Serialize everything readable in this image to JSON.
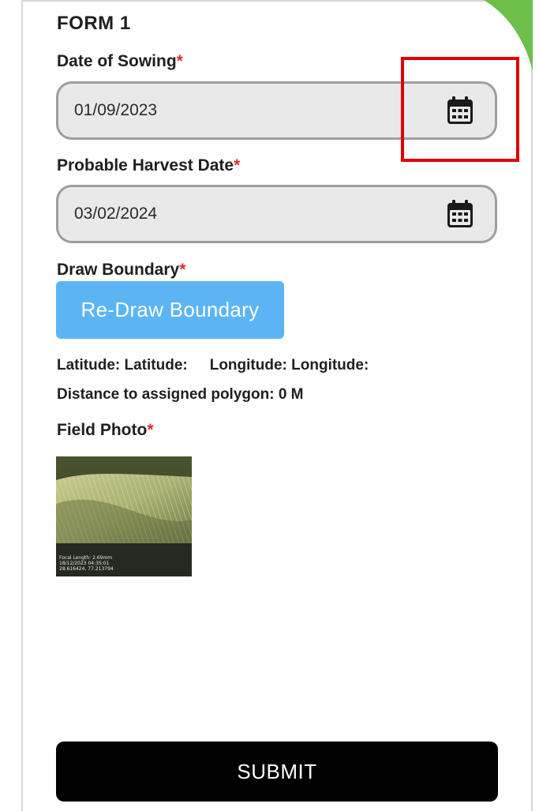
{
  "form": {
    "title": "FORM 1"
  },
  "sowing": {
    "label": "Date of Sowing",
    "required_mark": "*",
    "value": "01/09/2023"
  },
  "harvest": {
    "label": "Probable Harvest Date",
    "required_mark": "*",
    "value": "03/02/2024"
  },
  "boundary": {
    "label": "Draw Boundary",
    "required_mark": "*",
    "button_label": "Re-Draw Boundary"
  },
  "location": {
    "latitude_label": "Latitude:",
    "latitude_value": "Latitude:",
    "longitude_label": "Longitude:",
    "longitude_value": "Longitude:",
    "distance_text": "Distance to assigned polygon: 0 M"
  },
  "photo": {
    "label": "Field Photo",
    "required_mark": "*",
    "caption_lines": [
      "Focal Length: 2.69mm",
      "18/12/2023 04:35:01",
      "28.616424, 77.213794"
    ]
  },
  "actions": {
    "submit_label": "SUBMIT"
  },
  "icons": {
    "calendar": "calendar-icon"
  },
  "colors": {
    "accent_blue": "#5bb5f5",
    "required_red": "#d32f2f",
    "highlight_red": "#e00000",
    "corner_green": "#6cc04a",
    "submit_black": "#000000"
  }
}
